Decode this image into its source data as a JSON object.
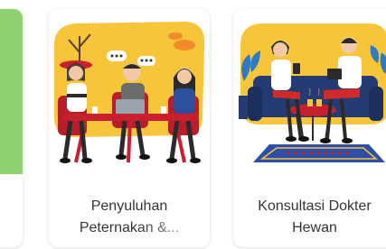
{
  "carousel": {
    "cards": [
      {
        "id": "partial",
        "accent_color": "#8fd16f"
      },
      {
        "label_line1": "Penyuluhan",
        "label_line2": "Peternakan &...",
        "image": "meeting-discussion-illustration"
      },
      {
        "label_line1": "Konsultasi Dokter",
        "label_line2": "Hewan",
        "image": "vet-consultation-illustration"
      }
    ]
  },
  "colors": {
    "accent_green": "#8fd16f",
    "yellow": "#f7c539",
    "red": "#c9202f",
    "navy": "#243b73",
    "text": "#333333"
  }
}
